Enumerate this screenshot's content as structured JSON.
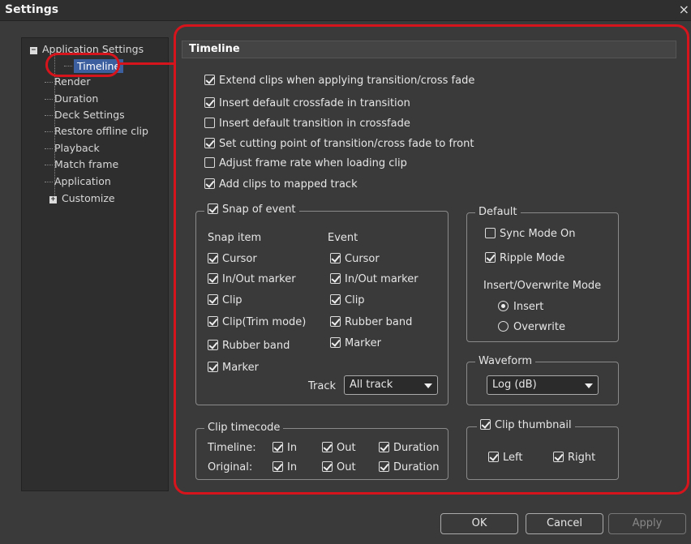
{
  "window": {
    "title": "Settings",
    "close_glyph": "×"
  },
  "tree": {
    "root": "Application Settings",
    "items": [
      "Timeline",
      "Render",
      "Duration",
      "Deck Settings",
      "Restore offline clip",
      "Playback",
      "Match frame",
      "Application"
    ],
    "customize": "Customize",
    "selected": "Timeline"
  },
  "panel": {
    "title": "Timeline",
    "options": [
      {
        "label": "Extend clips when applying transition/cross fade",
        "checked": true
      },
      {
        "label": "Insert default crossfade in transition",
        "checked": true
      },
      {
        "label": "Insert default transition in crossfade",
        "checked": false
      },
      {
        "label": "Set cutting point of transition/cross fade to front",
        "checked": true
      },
      {
        "label": "Adjust frame rate when loading clip",
        "checked": false
      },
      {
        "label": "Add clips to mapped track",
        "checked": true
      }
    ],
    "snap": {
      "label": "Snap of event",
      "snap_item_header": "Snap item",
      "event_header": "Event",
      "snap_items": [
        "Cursor",
        "In/Out marker",
        "Clip",
        "Clip(Trim mode)",
        "Rubber band",
        "Marker"
      ],
      "event_items": [
        "Cursor",
        "In/Out marker",
        "Clip",
        "Rubber band",
        "Marker"
      ],
      "track_label": "Track",
      "track_value": "All track"
    },
    "default": {
      "label": "Default",
      "sync_mode": "Sync Mode On",
      "ripple_mode": "Ripple Mode",
      "io_mode_label": "Insert/Overwrite Mode",
      "insert": "Insert",
      "overwrite": "Overwrite"
    },
    "waveform": {
      "label": "Waveform",
      "value": "Log (dB)"
    },
    "clip_timecode": {
      "label": "Clip timecode",
      "timeline": "Timeline:",
      "original": "Original:",
      "in": "In",
      "out": "Out",
      "duration": "Duration"
    },
    "clip_thumbnail": {
      "label": "Clip thumbnail",
      "left": "Left",
      "right": "Right"
    }
  },
  "buttons": {
    "ok": "OK",
    "cancel": "Cancel",
    "apply": "Apply"
  },
  "colors": {
    "highlight": "#d6141c",
    "selection": "#3c5fa0"
  }
}
